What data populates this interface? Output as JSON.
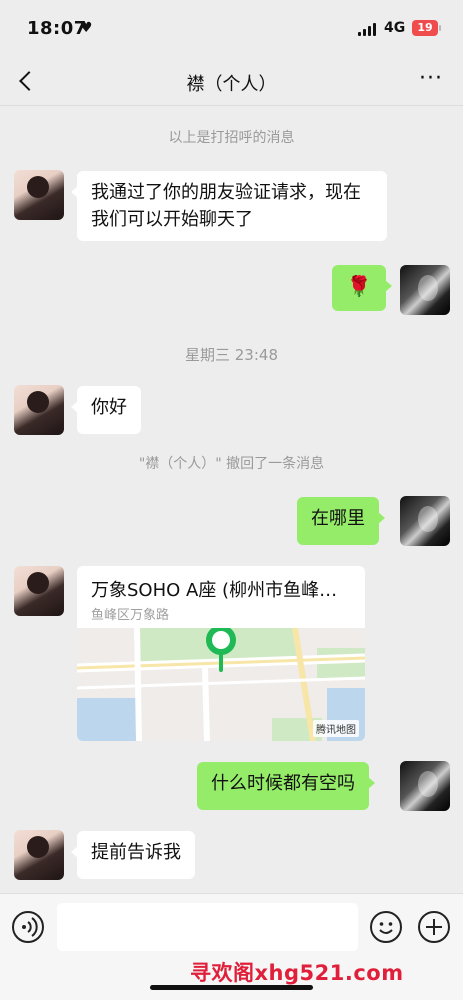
{
  "status_bar": {
    "time": "18:07",
    "network": "4G",
    "battery": "19"
  },
  "nav": {
    "title": "襟（个人）"
  },
  "messages": {
    "greeting_note": "以上是打招呼的消息",
    "m1": "我通过了你的朋友验证请求，现在我们可以开始聊天了",
    "m2": "🌹",
    "timestamp": "星期三 23:48",
    "m3": "你好",
    "recall_note": "\"襟（个人）\" 撤回了一条消息",
    "m4": "在哪里",
    "location": {
      "title": "万象SOHO A座 (柳州市鱼峰区万象路",
      "address": "鱼峰区万象路",
      "map_credit": "腾讯地图"
    },
    "m5": "什么时候都有空吗",
    "m6": "提前告诉我"
  },
  "watermark": "寻欢阁xhg521.com",
  "colors": {
    "outgoing_bubble": "#95ec69",
    "incoming_bubble": "#ffffff",
    "background": "#ededed",
    "map_pin": "#1fb955"
  },
  "icons": {
    "back": "chevron-left-icon",
    "more": "more-icon",
    "voice": "voice-icon",
    "emoji": "emoji-icon",
    "plus": "plus-icon"
  }
}
